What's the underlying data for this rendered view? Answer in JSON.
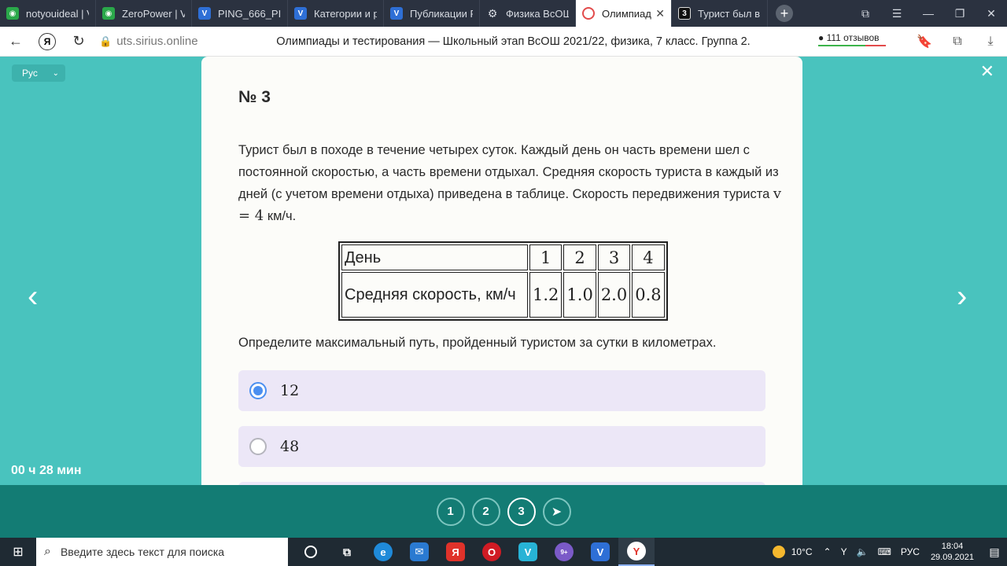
{
  "browser": {
    "tabs": [
      {
        "label": "notyouideal | V",
        "favicon": "green-cat-icon",
        "color": "#2aa84a"
      },
      {
        "label": "ZeroPower | Vi",
        "favicon": "green-cat-icon",
        "color": "#2aa84a"
      },
      {
        "label": "PING_666_PIN",
        "favicon": "blue-v-icon",
        "color": "#2e6fd6"
      },
      {
        "label": "Категории и р",
        "favicon": "blue-v-icon",
        "color": "#2e6fd6"
      },
      {
        "label": "Публикации Р",
        "favicon": "blue-v-icon",
        "color": "#2e6fd6"
      },
      {
        "label": "Физика ВсОШ",
        "favicon": "gear-icon",
        "color": "#d7dbe2"
      },
      {
        "label": "Олимпиад",
        "favicon": "sirius-icon",
        "color": "#e24b4b",
        "active": true
      },
      {
        "label": "Турист был в г",
        "favicon": "number-3-icon",
        "color": "#111111"
      }
    ],
    "url": "uts.sirius.online",
    "page_title": "Олимпиады и тестирования — Школьный этап ВсОШ 2021/22, физика, 7 класс. Группа 2.",
    "reviews": "111 отзывов"
  },
  "page": {
    "language": "Рус",
    "timer": "00 ч 28 мин",
    "question_number": "№ 3",
    "question_text_before": "Турист был в походе в течение четырех суток. Каждый день он часть времени шел с постоянной скоростью, а часть времени отдыхал. Средняя скорость туриста в каждый из дней (с учетом времени отдыха) приведена в таблице. Скорость передвижения туриста ",
    "question_math": "v = 4",
    "question_text_after": " км/ч.",
    "table": {
      "row1_label": "День",
      "days": [
        "1",
        "2",
        "3",
        "4"
      ],
      "row2_label": "Средняя скорость, км/ч",
      "speeds": [
        "1.2",
        "1.0",
        "2.0",
        "0.8"
      ]
    },
    "prompt": "Определите максимальный путь, пройденный туристом за сутки в километрах.",
    "options": [
      {
        "value": "12",
        "selected": true
      },
      {
        "value": "48",
        "selected": false
      }
    ],
    "pagination": [
      "1",
      "2",
      "3"
    ],
    "active_page": "3",
    "accent_color": "#49c3be"
  },
  "taskbar": {
    "search_placeholder": "Введите здесь текст для поиска",
    "weather": "10°C",
    "language": "РУС",
    "time": "18:04",
    "date": "29.09.2021",
    "mail_badge": "9+"
  }
}
